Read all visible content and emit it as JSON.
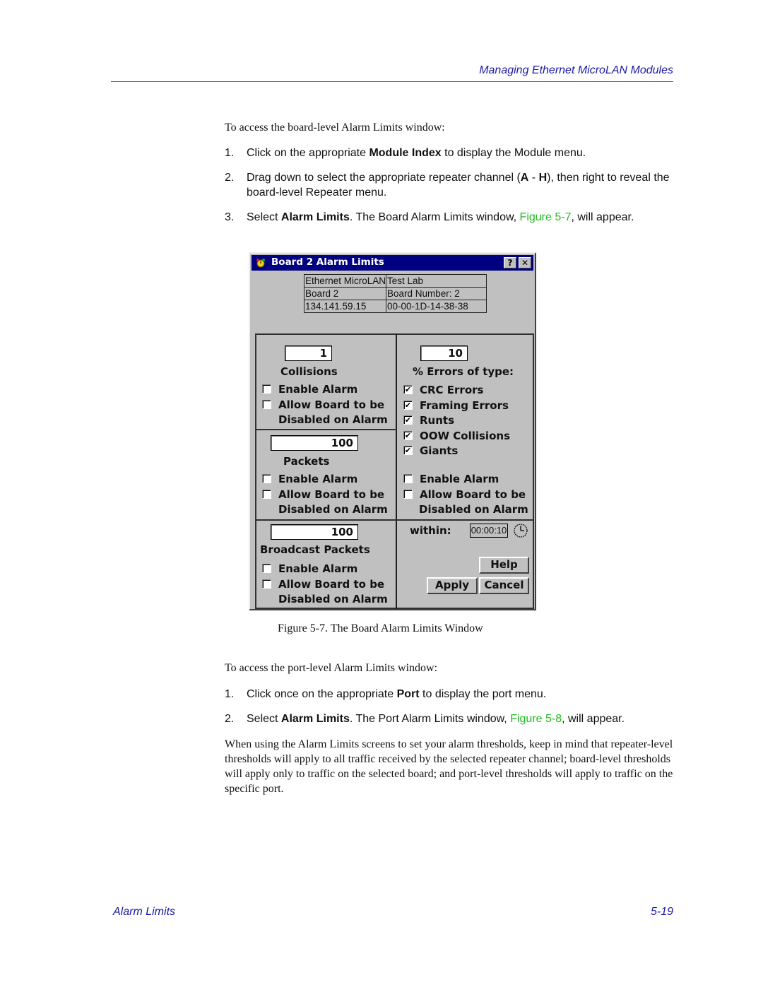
{
  "header": {
    "title": "Managing Ethernet MicroLAN Modules"
  },
  "intro_board": "To access the board-level Alarm Limits window:",
  "steps_board": [
    {
      "num": "1.",
      "pre": "Click on the appropriate ",
      "bold": "Module Index",
      "post": " to display the Module menu."
    },
    {
      "num": "2.",
      "pre": "Drag down to select the appropriate repeater channel (",
      "bold": "A",
      "mid": " - ",
      "bold2": "H",
      "post": "), then right to reveal the board-level Repeater menu."
    },
    {
      "num": "3.",
      "pre": "Select ",
      "bold": "Alarm Limits",
      "mid": ". The Board Alarm Limits window, ",
      "link": "Figure 5-7",
      "post": ", will appear."
    }
  ],
  "dialog": {
    "title": "Board 2 Alarm Limits",
    "help_btn": "?",
    "close_btn": "✕",
    "info": [
      [
        "Ethernet MicroLAN",
        "Test Lab"
      ],
      [
        "Board 2",
        "Board Number:  2"
      ],
      [
        "134.141.59.15",
        "00-00-1D-14-38-38"
      ]
    ],
    "collisions": {
      "value": "1",
      "label": "Collisions",
      "enable": "Enable Alarm",
      "allow1": "Allow Board to be",
      "allow2": "Disabled on Alarm",
      "enable_checked": false,
      "allow_checked": false
    },
    "packets": {
      "value": "100",
      "label": "Packets",
      "enable": "Enable Alarm",
      "allow1": "Allow Board to be",
      "allow2": "Disabled on Alarm",
      "enable_checked": false,
      "allow_checked": false
    },
    "broadcast": {
      "value": "100",
      "label": "Broadcast Packets",
      "enable": "Enable Alarm",
      "allow1": "Allow Board to be",
      "allow2": "Disabled on Alarm",
      "enable_checked": false,
      "allow_checked": false
    },
    "errors": {
      "value": "10",
      "label": "% Errors of type:",
      "types": [
        {
          "label": "CRC Errors",
          "checked": true
        },
        {
          "label": "Framing Errors",
          "checked": true
        },
        {
          "label": "Runts",
          "checked": true
        },
        {
          "label": "OOW Collisions",
          "checked": true
        },
        {
          "label": "Giants",
          "checked": true
        }
      ],
      "enable": "Enable Alarm",
      "allow1": "Allow Board to be",
      "allow2": "Disabled on Alarm",
      "enable_checked": false,
      "allow_checked": false
    },
    "within_label": "within:",
    "within_value": "00:00:10",
    "buttons": {
      "help": "Help",
      "apply": "Apply",
      "cancel": "Cancel"
    }
  },
  "caption": "Figure 5-7.  The Board Alarm Limits Window",
  "intro_port": "To access the port-level Alarm Limits window:",
  "steps_port": [
    {
      "num": "1.",
      "pre": "Click once on the appropriate ",
      "bold": "Port",
      "post": " to display the port menu."
    },
    {
      "num": "2.",
      "pre": "Select ",
      "bold": "Alarm Limits",
      "mid": ". The Port Alarm Limits window, ",
      "link": "Figure 5-8",
      "post": ", will appear."
    }
  ],
  "paragraph": "When using the Alarm Limits screens to set your alarm thresholds, keep in mind that repeater-level thresholds will apply to all traffic received by the selected repeater channel; board-level thresholds will apply only to traffic on the selected board; and port-level thresholds will apply to traffic on the specific port.",
  "footer": {
    "section": "Alarm Limits",
    "page": "5-19"
  },
  "colors": {
    "header_blue": "#1a1aa6",
    "link_green": "#22bb22",
    "titlebar": "#000080",
    "dialog_face": "#c0c0c0"
  }
}
